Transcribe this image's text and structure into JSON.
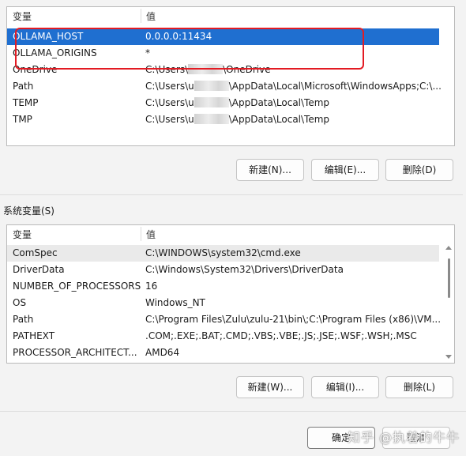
{
  "user_vars": {
    "col_name": "变量",
    "col_value": "值",
    "rows": [
      {
        "name": "OLLAMA_HOST",
        "value": "0.0.0.0:11434"
      },
      {
        "name": "OLLAMA_ORIGINS",
        "value": "*"
      },
      {
        "name": "OneDrive",
        "value_pre": "C:\\Users\\",
        "value_post": "\\OneDrive"
      },
      {
        "name": "Path",
        "value_pre": "C:\\Users\\u",
        "value_post": "\\AppData\\Local\\Microsoft\\WindowsApps;C:\\..."
      },
      {
        "name": "TEMP",
        "value_pre": "C:\\Users\\u",
        "value_post": "\\AppData\\Local\\Temp"
      },
      {
        "name": "TMP",
        "value_pre": "C:\\Users\\u",
        "value_post": "\\AppData\\Local\\Temp"
      }
    ],
    "buttons": {
      "new": "新建(N)...",
      "edit": "编辑(E)...",
      "delete": "删除(D)"
    }
  },
  "system_vars": {
    "title": "系统变量(S)",
    "col_name": "变量",
    "col_value": "值",
    "rows": [
      {
        "name": "ComSpec",
        "value": "C:\\WINDOWS\\system32\\cmd.exe"
      },
      {
        "name": "DriverData",
        "value": "C:\\Windows\\System32\\Drivers\\DriverData"
      },
      {
        "name": "NUMBER_OF_PROCESSORS",
        "value": "16"
      },
      {
        "name": "OS",
        "value": "Windows_NT"
      },
      {
        "name": "Path",
        "value": "C:\\Program Files\\Zulu\\zulu-21\\bin\\;C:\\Program Files (x86)\\VM..."
      },
      {
        "name": "PATHEXT",
        "value": ".COM;.EXE;.BAT;.CMD;.VBS;.VBE;.JS;.JSE;.WSF;.WSH;.MSC"
      },
      {
        "name": "PROCESSOR_ARCHITECT...",
        "value": "AMD64"
      }
    ],
    "buttons": {
      "new": "新建(W)...",
      "edit": "编辑(I)...",
      "delete": "删除(L)"
    }
  },
  "footer": {
    "ok": "确定",
    "cancel": "取消"
  },
  "watermark": "知乎 @执着的牛牛",
  "colors": {
    "selection": "#1f6fd0",
    "highlight_box": "#e31b23"
  }
}
